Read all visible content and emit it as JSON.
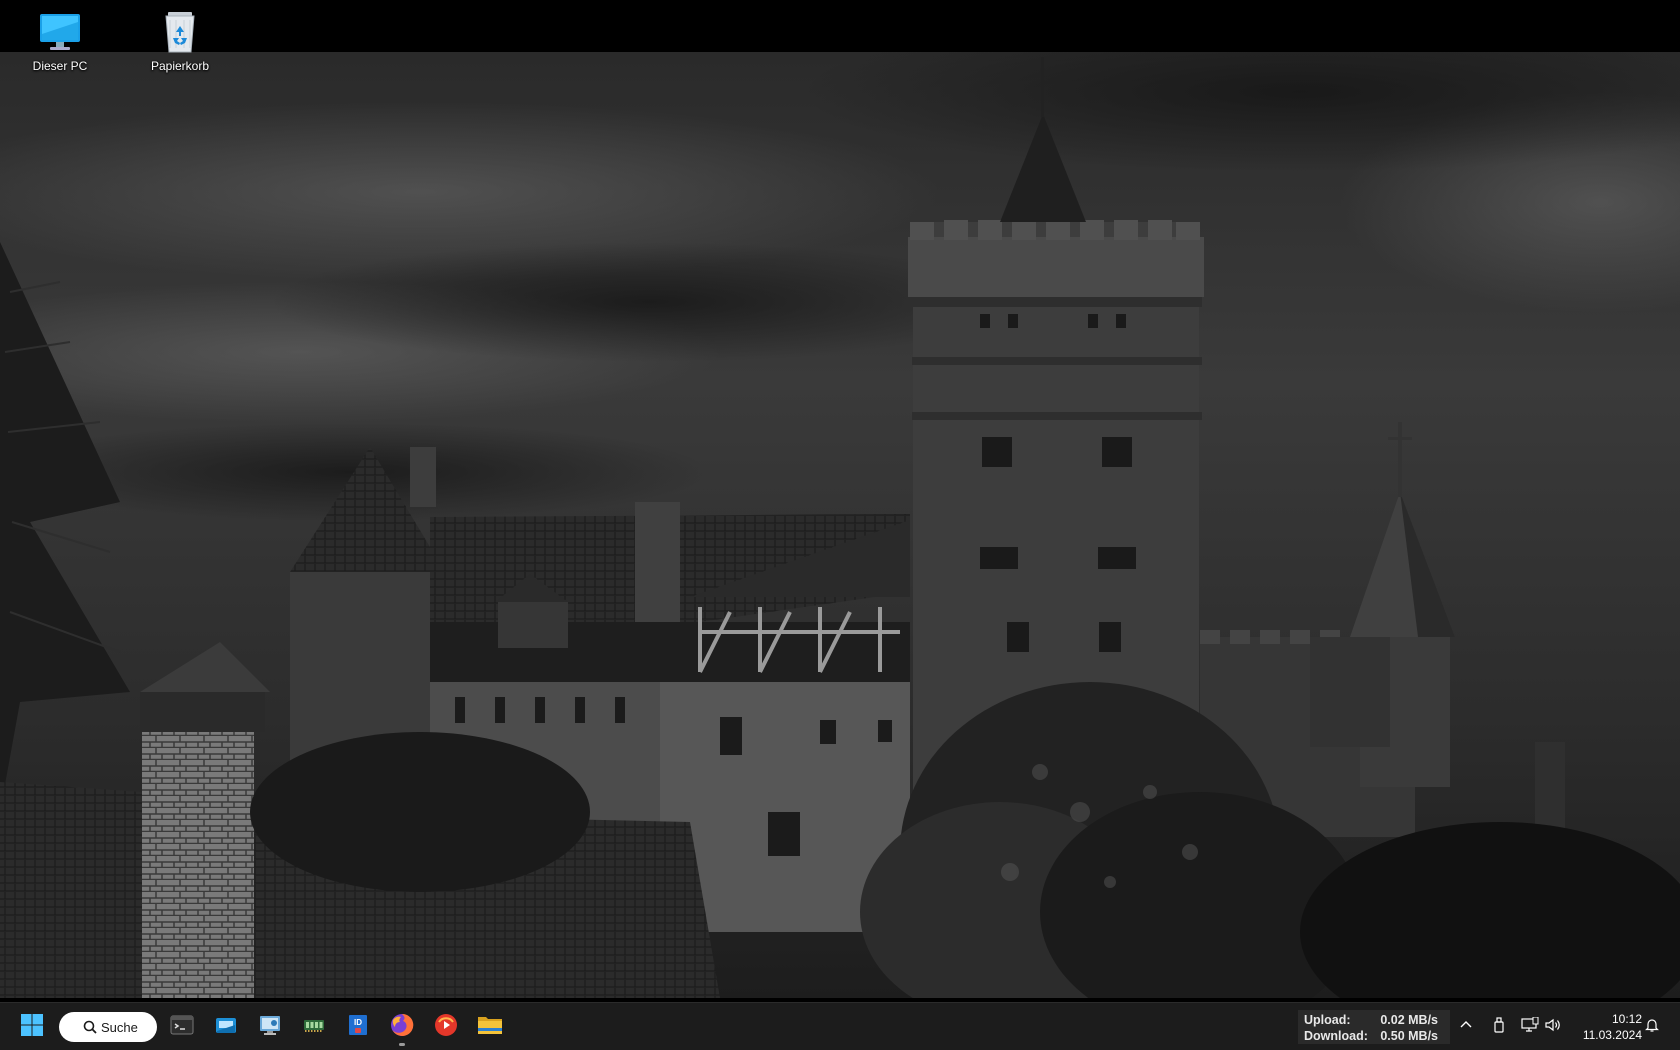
{
  "desktop": {
    "icons": [
      {
        "label": "Dieser PC",
        "icon": "this-pc-icon"
      },
      {
        "label": "Papierkorb",
        "icon": "recycle-bin-icon"
      }
    ]
  },
  "taskbar": {
    "start_icon": "windows-start-icon",
    "search": {
      "label": "Suche"
    },
    "pinned": [
      {
        "name": "terminal",
        "icon": "terminal-icon",
        "running": false
      },
      {
        "name": "app-blue-window",
        "icon": "app-window-icon",
        "running": false
      },
      {
        "name": "remote-desktop",
        "icon": "remote-desktop-icon",
        "running": false
      },
      {
        "name": "ram-monitor",
        "icon": "memory-chip-icon",
        "running": false
      },
      {
        "name": "id-app",
        "icon": "id-card-icon",
        "running": false
      },
      {
        "name": "firefox",
        "icon": "firefox-icon",
        "running": true
      },
      {
        "name": "media-player",
        "icon": "media-player-icon",
        "running": false
      },
      {
        "name": "file-explorer",
        "icon": "folder-icon",
        "running": false
      }
    ],
    "network_speed": {
      "upload_label": "Upload:",
      "upload_value": "0.02 MB/s",
      "download_label": "Download:",
      "download_value": "0.50 MB/s"
    },
    "tray": {
      "overflow_icon": "chevron-up-icon",
      "usb_icon": "usb-drive-icon",
      "network_icon": "network-icon",
      "volume_icon": "speaker-icon",
      "notification_icon": "bell-icon"
    },
    "clock": {
      "time": "10:12",
      "date": "11.03.2024"
    }
  },
  "colors": {
    "taskbar_bg": "#1c1c1c",
    "accent_blue": "#4cc2ff",
    "firefox_orange": "#ff7139",
    "folder_yellow": "#f4c33a"
  }
}
